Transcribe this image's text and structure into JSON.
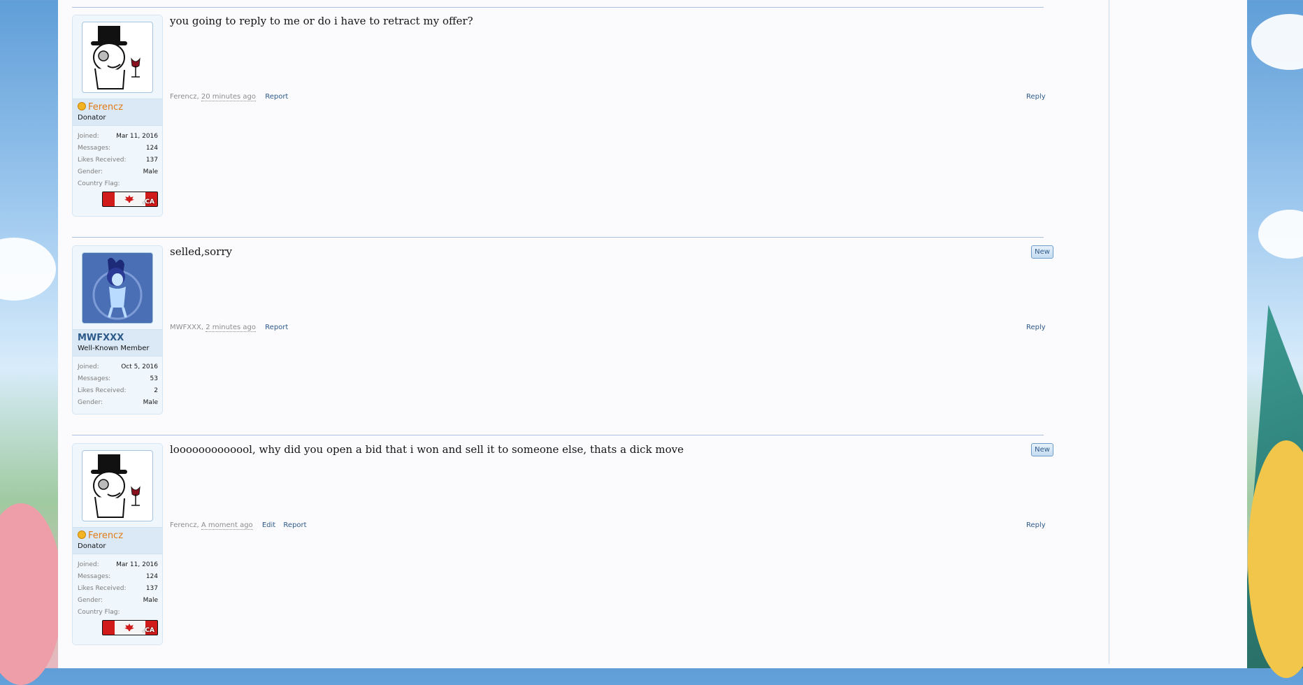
{
  "theme": {
    "link_color": "#2e5a8a",
    "donator_color": "#e07a16",
    "separator_color": "#a9c3df"
  },
  "posts": [
    {
      "username": "Ferencz",
      "user_title": "Donator",
      "avatar_icon": "monocle-gentleman-avatar",
      "stats": [
        {
          "label": "Joined:",
          "value": "Mar 11, 2016"
        },
        {
          "label": "Messages:",
          "value": "124"
        },
        {
          "label": "Likes Received:",
          "value": "137"
        },
        {
          "label": "Gender:",
          "value": "Male"
        }
      ],
      "country_flag_label": "Country Flag:",
      "flag_tld": ".CA",
      "message": "you going to reply to me or do i have to retract my offer?",
      "author_meta": "Ferencz,",
      "time": "20 minutes ago",
      "report": "Report",
      "reply": "Reply"
    },
    {
      "username": "MWFXXX",
      "user_title": "Well-Known Member",
      "avatar_icon": "anime-character-avatar",
      "stats": [
        {
          "label": "Joined:",
          "value": "Oct 5, 2016"
        },
        {
          "label": "Messages:",
          "value": "53"
        },
        {
          "label": "Likes Received:",
          "value": "2"
        },
        {
          "label": "Gender:",
          "value": "Male"
        }
      ],
      "new_badge": "New",
      "message": "selled,sorry",
      "author_meta": "MWFXXX,",
      "time": "2 minutes ago",
      "report": "Report",
      "reply": "Reply"
    },
    {
      "username": "Ferencz",
      "user_title": "Donator",
      "avatar_icon": "monocle-gentleman-avatar",
      "stats": [
        {
          "label": "Joined:",
          "value": "Mar 11, 2016"
        },
        {
          "label": "Messages:",
          "value": "124"
        },
        {
          "label": "Likes Received:",
          "value": "137"
        },
        {
          "label": "Gender:",
          "value": "Male"
        }
      ],
      "country_flag_label": "Country Flag:",
      "flag_tld": ".CA",
      "new_badge": "New",
      "message": "looooooooooool, why did you open a bid that i won and sell it to someone else, thats a dick move",
      "author_meta": "Ferencz,",
      "time": "A moment ago",
      "edit": "Edit",
      "report": "Report",
      "reply": "Reply"
    }
  ]
}
